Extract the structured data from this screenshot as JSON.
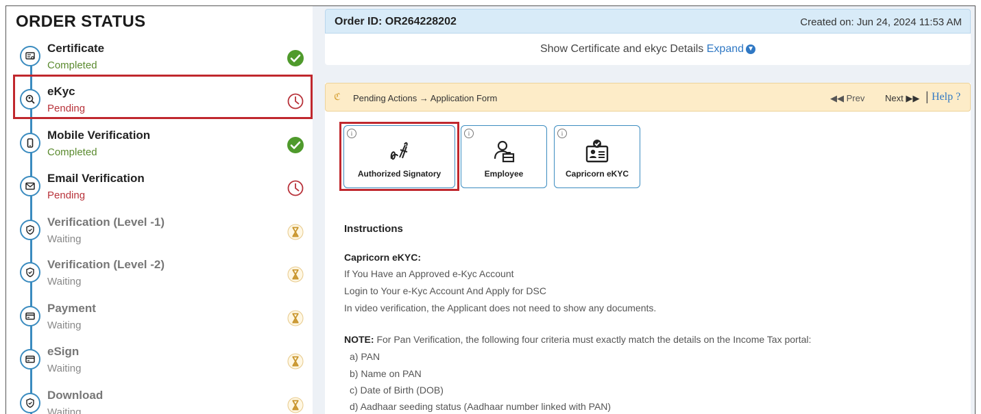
{
  "sidebar": {
    "title": "ORDER STATUS",
    "steps": [
      {
        "name": "Certificate",
        "status": "Completed",
        "state": "completed",
        "icon": "certificate-icon"
      },
      {
        "name": "eKyc",
        "status": "Pending",
        "state": "pending",
        "icon": "search-icon"
      },
      {
        "name": "Mobile Verification",
        "status": "Completed",
        "state": "completed",
        "icon": "mobile-icon"
      },
      {
        "name": "Email Verification",
        "status": "Pending",
        "state": "pending",
        "icon": "mail-icon"
      },
      {
        "name": "Verification (Level -1)",
        "status": "Waiting",
        "state": "waiting",
        "icon": "shield-icon"
      },
      {
        "name": "Verification (Level -2)",
        "status": "Waiting",
        "state": "waiting",
        "icon": "shield-icon"
      },
      {
        "name": "Payment",
        "status": "Waiting",
        "state": "waiting",
        "icon": "card-icon"
      },
      {
        "name": "eSign",
        "status": "Waiting",
        "state": "waiting",
        "icon": "card-icon"
      },
      {
        "name": "Download",
        "status": "Waiting",
        "state": "waiting",
        "icon": "shield-icon"
      }
    ]
  },
  "order": {
    "id_label": "Order ID: OR264228202",
    "created": "Created on: Jun 24, 2024 11:53 AM",
    "show_text": "Show Certificate and ekyc Details",
    "expand_label": "Expand"
  },
  "pending_bar": {
    "text": "Pending Actions → Application Form",
    "prev": "Prev",
    "next": "Next",
    "help": "Help ?"
  },
  "tiles": [
    {
      "label": "Authorized Signatory",
      "icon": "signature-icon"
    },
    {
      "label": "Employee",
      "icon": "employee-icon"
    },
    {
      "label": "Capricorn eKYC",
      "icon": "id-card-check-icon"
    }
  ],
  "instructions": {
    "heading": "Instructions",
    "sub_heading": "Capricorn eKYC:",
    "line1": "If You Have an Approved e-Kyc Account",
    "line2": "Login to Your e-Kyc Account And Apply for DSC",
    "line3": "In video verification, the Applicant does not need to show any documents.",
    "note_label": "NOTE:",
    "note_text": " For Pan Verification, the following four criteria must exactly match the details on the Income Tax portal:",
    "criteria": [
      "a) PAN",
      "b) Name on PAN",
      "c) Date of Birth (DOB)",
      "d) Aadhaar seeding status (Aadhaar number linked with PAN)"
    ]
  },
  "colors": {
    "accent": "#3a8bbf",
    "pending": "#b8323a",
    "completed": "#4f9a2c",
    "highlight": "#c0272d",
    "waiting": "#d7a33a"
  }
}
